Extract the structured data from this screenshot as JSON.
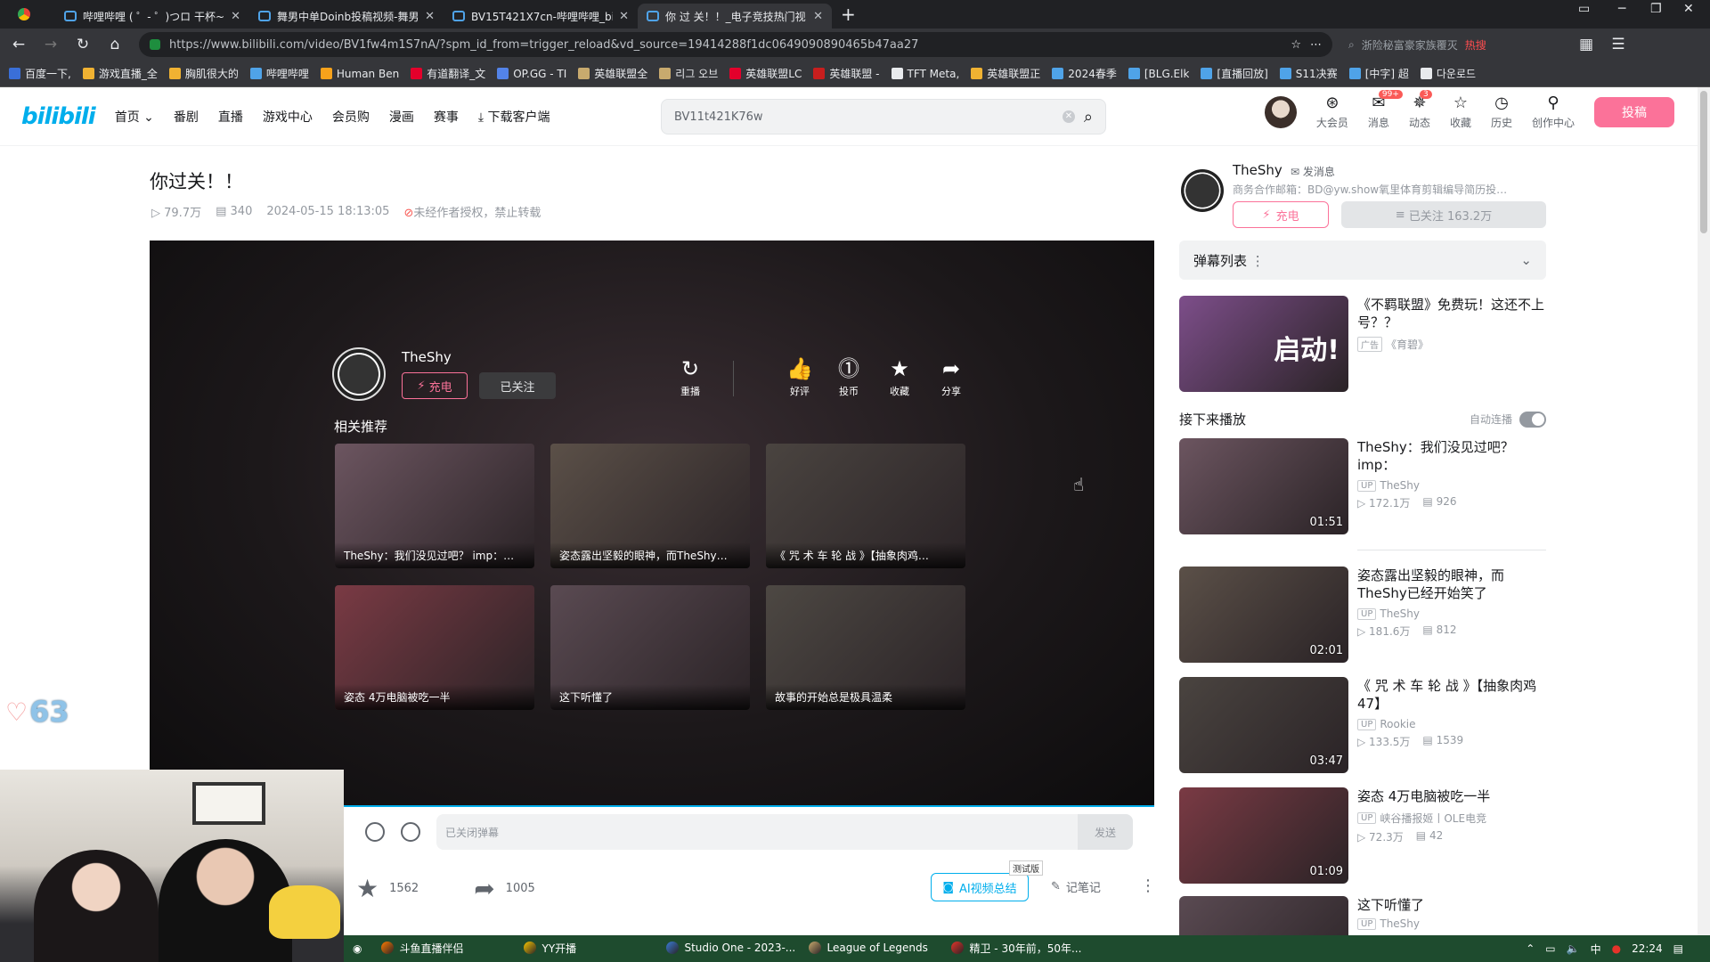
{
  "browser": {
    "tabs": [
      {
        "label": "哔哩哔哩 ( ゜- ゜)つロ 干杯~"
      },
      {
        "label": "舞男中单Doinb投稿视频-舞男"
      },
      {
        "label": "BV15T421X7cn-哔哩哔哩_bi"
      },
      {
        "label": "你 过 关！！_电子竞技热门视"
      }
    ],
    "url": "https://www.bilibili.com/video/BV1fw4m1S7nA/?spm_id_from=trigger_reload&vd_source=19414288f1dc0649090890465b47aa27",
    "side_search_placeholder": "浙险秘富豪家族覆灭",
    "side_search_hot": "热搜",
    "bookmarks": [
      "百度一下,",
      "游戏直播_全",
      "胸肌很大的",
      "哔哩哔哩",
      "Human Ben",
      "有道翻译_文",
      "OP.GG - TI",
      "英雄联盟全",
      "리그 오브",
      "英雄联盟LC",
      "英雄联盟 -",
      "TFT Meta,",
      "英雄联盟正",
      "2024春季",
      "[BLG.Elk",
      "[直播回放]",
      "S11决赛",
      "[中字] 超",
      "다운로드"
    ]
  },
  "header": {
    "logo": "bilibili",
    "nav": [
      {
        "label": "首页",
        "arrow": "⌄"
      },
      {
        "label": "番剧"
      },
      {
        "label": "直播"
      },
      {
        "label": "游戏中心"
      },
      {
        "label": "会员购"
      },
      {
        "label": "漫画"
      },
      {
        "label": "赛事"
      },
      {
        "label": "下载客户端"
      }
    ],
    "search_value": "BV11t421K76w",
    "icons": [
      {
        "label": "大会员",
        "glyph": "⊛"
      },
      {
        "label": "消息",
        "glyph": "✉",
        "badge": "99+"
      },
      {
        "label": "动态",
        "glyph": "✵",
        "badge": "3"
      },
      {
        "label": "收藏",
        "glyph": "☆"
      },
      {
        "label": "历史",
        "glyph": "◷"
      },
      {
        "label": "创作中心",
        "glyph": "⚲"
      }
    ],
    "upload_label": "投稿"
  },
  "video": {
    "title": "你过关！！",
    "views": "79.7万",
    "danmaku": "340",
    "date": "2024-05-15 18:13:05",
    "copyright": "未经作者授权，禁止转载"
  },
  "player": {
    "uploader": "TheShy",
    "charge_label": "充电",
    "followed_label": "已关注",
    "actions": [
      {
        "label": "重播",
        "glyph": "↻"
      },
      {
        "label": "好评",
        "glyph": "👍"
      },
      {
        "label": "投币",
        "glyph": "⓵"
      },
      {
        "label": "收藏",
        "glyph": "★"
      },
      {
        "label": "分享",
        "glyph": "➦"
      }
    ],
    "related_title": "相关推荐",
    "related": [
      {
        "caption": "TheShy：我们没见过吧？ imp：…",
        "color": "#6c5560"
      },
      {
        "caption": "姿态露出坚毅的眼神，而TheShy…",
        "color": "#5b5048"
      },
      {
        "caption": "《 咒 术 车 轮 战 》【抽象肉鸡…",
        "color": "#4a4440"
      },
      {
        "caption": "姿态 4万电脑被吃一半",
        "color": "#7a3a44"
      },
      {
        "caption": "这下听懂了",
        "color": "#5a4a52"
      },
      {
        "caption": "故事的开始总是极具温柔",
        "color": "#4d4843"
      }
    ]
  },
  "danmaku_bar": {
    "placeholder": "已关闭弹幕",
    "send_label": "发送"
  },
  "toolbar": {
    "fav_count": "1562",
    "share_count": "1005",
    "ai_label": "AI视频总结",
    "beta_label": "测试版",
    "note_label": "记笔记"
  },
  "overlay": {
    "heart_count": "63"
  },
  "sidebar": {
    "uploader": "TheShy",
    "message_label": "发消息",
    "description": "商务合作邮箱：BD@yw.show氧里体育剪辑编导简历投…",
    "charge_label": "充电",
    "follow_label": "已关注 163.2万",
    "danmaku_list_label": "弹幕列表",
    "ad": {
      "title": "《不羁联盟》免费玩！这还不上号？？",
      "tag": "广告",
      "source": "《育碧》",
      "color": "#7d4e8a",
      "thumb_text": "启动!"
    },
    "next_label": "接下来播放",
    "autoplay_label": "自动连播",
    "videos": [
      {
        "title": "TheShy：我们没见过吧？ imp：",
        "owner": "TheShy",
        "views": "172.1万",
        "danmaku": "926",
        "duration": "01:51",
        "color": "#6c5560"
      },
      {
        "title": "姿态露出坚毅的眼神，而TheShy已经开始笑了",
        "owner": "TheShy",
        "views": "181.6万",
        "danmaku": "812",
        "duration": "02:01",
        "color": "#5b5048"
      },
      {
        "title": "《 咒 术 车 轮 战 》【抽象肉鸡47】",
        "owner": "Rookie",
        "views": "133.5万",
        "danmaku": "1539",
        "duration": "03:47",
        "color": "#4a4440"
      },
      {
        "title": "姿态 4万电脑被吃一半",
        "owner": "峡谷播报姬丨OLE电竞",
        "views": "72.3万",
        "danmaku": "42",
        "duration": "01:09",
        "color": "#7a3a44"
      },
      {
        "title": "这下听懂了",
        "owner": "TheShy",
        "views": "",
        "danmaku": "",
        "duration": "",
        "color": "#5a4a52"
      }
    ]
  },
  "taskbar": {
    "items": [
      {
        "label": "斗鱼直播伴侣",
        "color": "#ff7a00"
      },
      {
        "label": "YY开播",
        "color": "#f5c400"
      },
      {
        "label": "Studio One - 2023-...",
        "color": "#3a7bd5"
      },
      {
        "label": "League of Legends",
        "color": "#c8aa6e"
      },
      {
        "label": "精卫 - 30年前，50年...",
        "color": "#e6332a"
      }
    ],
    "ime": "中",
    "time": "22:24"
  }
}
